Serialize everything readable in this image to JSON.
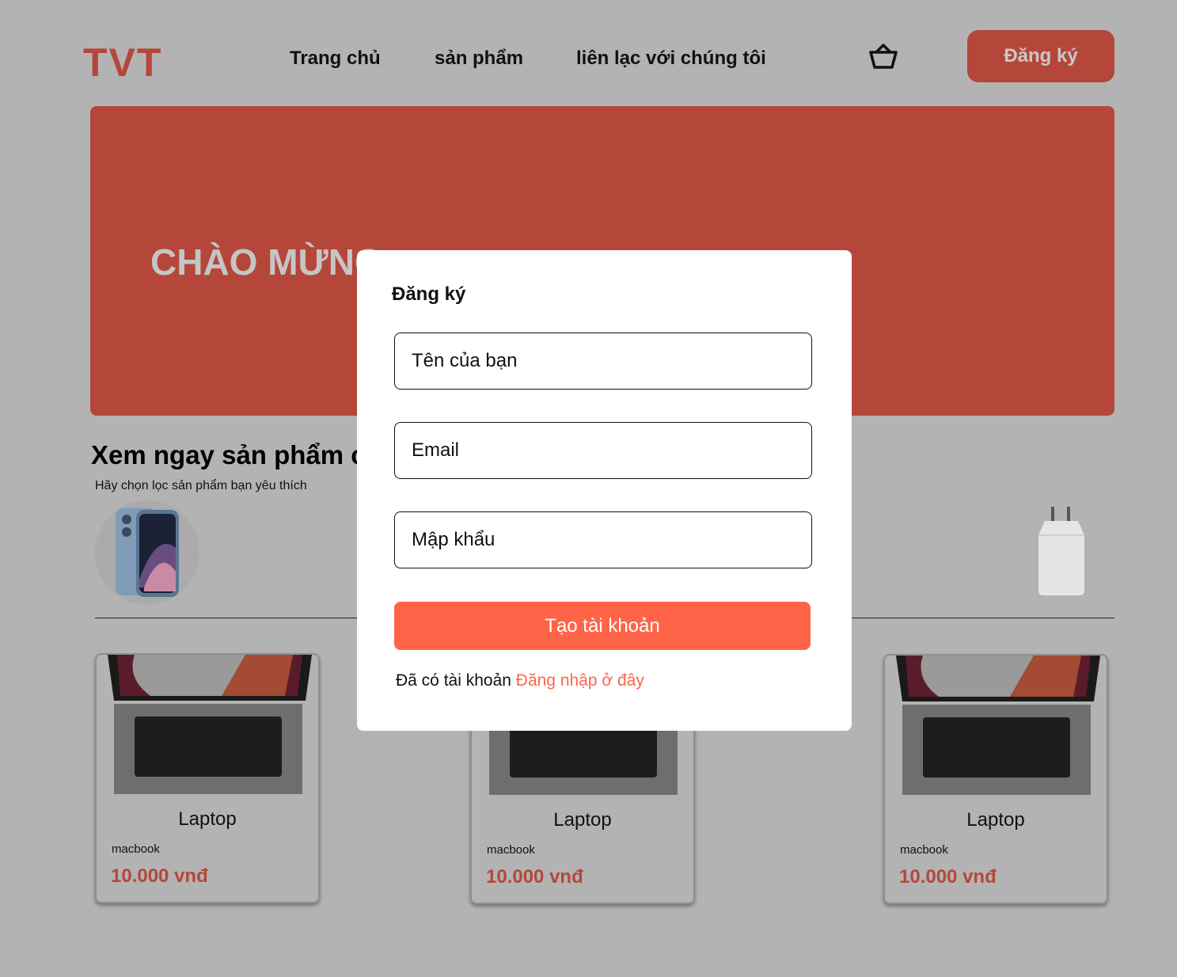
{
  "header": {
    "logo": "TVT",
    "nav": [
      "Trang chủ",
      "sản phẩm",
      "liên lạc với chúng tôi"
    ],
    "cart_icon": "basket-icon",
    "signup_label": "Đăng ký"
  },
  "hero": {
    "text": "CHÀO MỪNG"
  },
  "products_section": {
    "title": "Xem ngay sản phẩm c",
    "subtitle": "Hãy chọn lọc sản phẩm bạn yêu thích",
    "categories": [
      "phone-image",
      "charger-image"
    ]
  },
  "products": [
    {
      "name": "Laptop",
      "brand": "macbook",
      "price": "10.000 vnđ"
    },
    {
      "name": "Laptop",
      "brand": "macbook",
      "price": "10.000 vnđ"
    },
    {
      "name": "Laptop",
      "brand": "macbook",
      "price": "10.000 vnđ"
    }
  ],
  "modal": {
    "title": "Đăng ký",
    "name_placeholder": "Tên của bạn",
    "email_placeholder": "Email",
    "password_placeholder": "Mập khẩu",
    "submit_label": "Tạo tài khoản",
    "login_prompt": "Đã có tài khoản",
    "login_link": "Đăng nhập ở đây"
  },
  "colors": {
    "background": "#b3b3b3",
    "brand": "#b5473a",
    "accent": "#ff6448",
    "modal_bg": "#ffffff"
  }
}
